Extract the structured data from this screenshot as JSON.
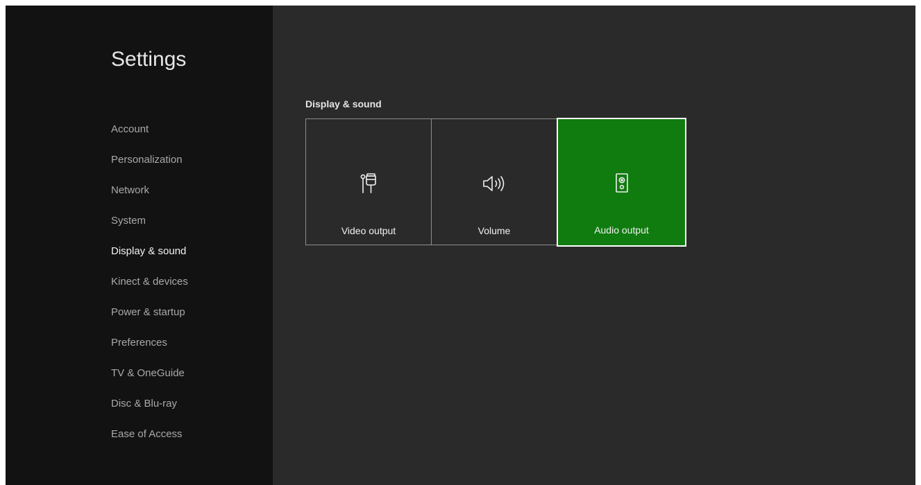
{
  "sidebar": {
    "title": "Settings",
    "items": [
      {
        "label": "Account"
      },
      {
        "label": "Personalization"
      },
      {
        "label": "Network"
      },
      {
        "label": "System"
      },
      {
        "label": "Display & sound",
        "active": true
      },
      {
        "label": "Kinect & devices"
      },
      {
        "label": "Power & startup"
      },
      {
        "label": "Preferences"
      },
      {
        "label": "TV & OneGuide"
      },
      {
        "label": "Disc & Blu-ray"
      },
      {
        "label": "Ease of Access"
      }
    ]
  },
  "main": {
    "section_title": "Display & sound",
    "tiles": [
      {
        "label": "Video output",
        "icon": "video-output-connector-icon"
      },
      {
        "label": "Volume",
        "icon": "volume-speaker-icon"
      },
      {
        "label": "Audio output",
        "icon": "audio-speaker-box-icon",
        "selected": true
      }
    ]
  },
  "colors": {
    "sidebar_bg": "#121212",
    "content_bg": "#2a2a2a",
    "accent_green": "#107c10",
    "text_active": "#f2f2f2",
    "text_inactive": "#a9a9a9"
  }
}
